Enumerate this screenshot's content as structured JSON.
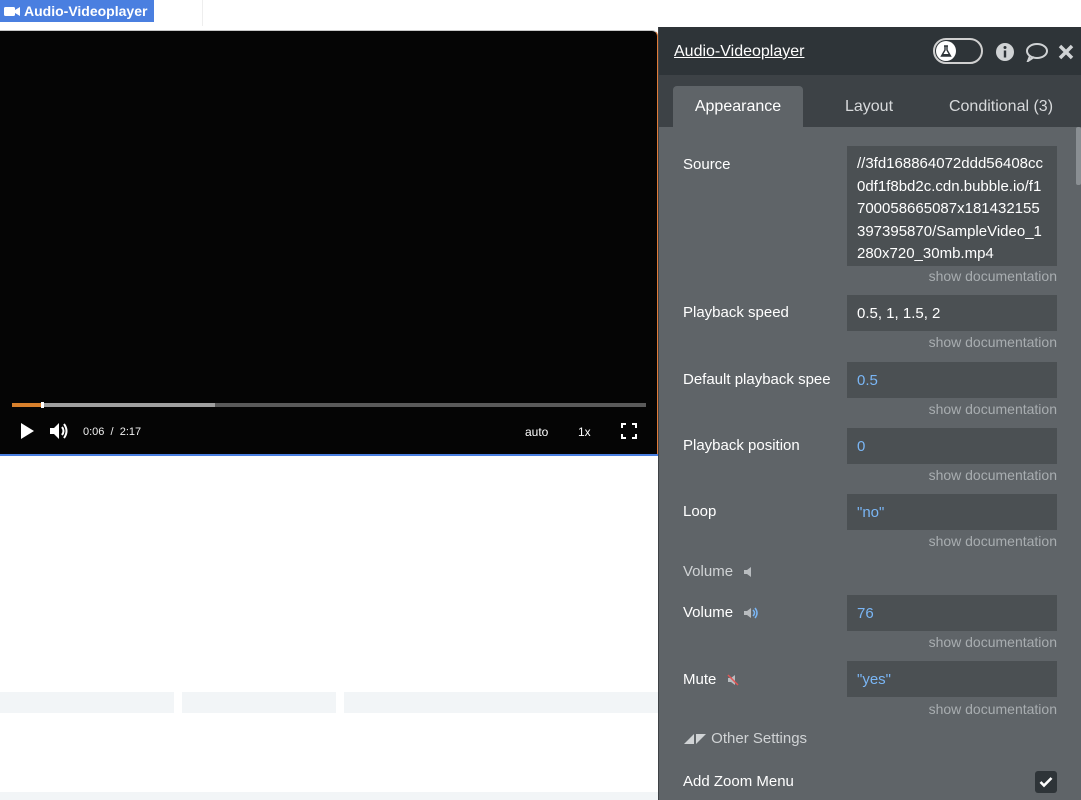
{
  "element_tab": {
    "label": "Audio-Videoplayer",
    "icon": "video-camera-icon"
  },
  "player": {
    "current_time": "0:06",
    "separator": "/",
    "duration": "2:17",
    "progress": 0.045,
    "buffered": 0.32,
    "quality_label": "auto",
    "speed_label": "1x",
    "icons": [
      "play-icon",
      "volume-icon",
      "fullscreen-icon"
    ]
  },
  "panel": {
    "title": "Audio-Videoplayer",
    "tabs": [
      {
        "label": "Appearance",
        "active": true
      },
      {
        "label": "Layout",
        "active": false
      },
      {
        "label": "Conditional (3)",
        "active": false
      }
    ],
    "doc_link": "show documentation",
    "fields": {
      "source": {
        "label": "Source",
        "value": "//3fd168864072ddd56408cc0df1f8bd2c.cdn.bubble.io/f1700058665087x181432155397395870/SampleVideo_1280x720_30mb.mp4"
      },
      "playback_speed": {
        "label": "Playback speed",
        "value": "0.5, 1, 1.5, 2"
      },
      "default_playback_speed": {
        "label": "Default playback spee",
        "value": "0.5"
      },
      "playback_position": {
        "label": "Playback position",
        "value": "0"
      },
      "loop": {
        "label": "Loop",
        "value": "\"no\""
      },
      "volume": {
        "label": "Volume",
        "value": "76"
      },
      "mute": {
        "label": "Mute",
        "value": "\"yes\""
      }
    },
    "volume_section": "Volume",
    "other_settings": "Other Settings",
    "add_zoom_menu": {
      "label": "Add Zoom Menu",
      "checked": true
    },
    "colors": {
      "header": "#2e3438",
      "panel": "#5f6468",
      "field": "#4b5053",
      "link_value": "#7ab6f5",
      "accent": "#4a7fe0"
    }
  }
}
